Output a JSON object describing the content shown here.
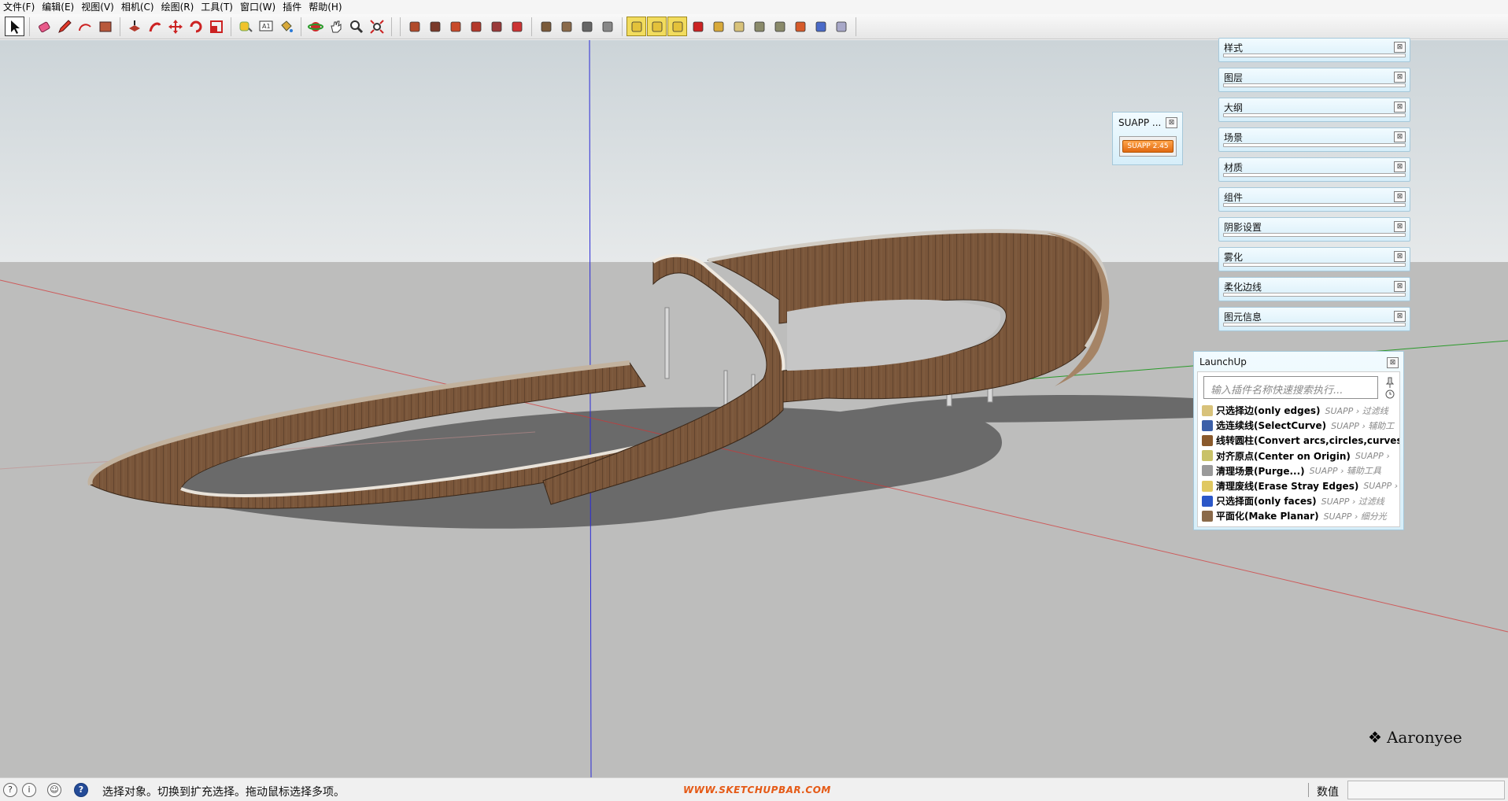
{
  "menubar": {
    "items": [
      "文件(F)",
      "编辑(E)",
      "视图(V)",
      "相机(C)",
      "绘图(R)",
      "工具(T)",
      "窗口(W)",
      "插件",
      "帮助(H)"
    ]
  },
  "toolbar": {
    "tools": [
      {
        "name": "select-tool",
        "icon": "arrow-icon",
        "active": true
      },
      {
        "name": "eraser-tool",
        "icon": "eraser-icon"
      },
      {
        "name": "pencil-tool",
        "icon": "pencil-icon"
      },
      {
        "name": "arc-tool",
        "icon": "arc-icon"
      },
      {
        "name": "shape-tool",
        "icon": "rectangle-icon"
      },
      {
        "name": "push-pull-tool",
        "icon": "push-pull-icon"
      },
      {
        "name": "follow-me-tool",
        "icon": "follow-me-icon"
      },
      {
        "name": "move-tool",
        "icon": "move-icon"
      },
      {
        "name": "rotate-tool",
        "icon": "rotate-icon"
      },
      {
        "name": "scale-tool",
        "icon": "scale-icon"
      },
      {
        "name": "tape-measure-tool",
        "icon": "tape-measure-icon"
      },
      {
        "name": "text-tool",
        "icon": "text-icon"
      },
      {
        "name": "paint-bucket-tool",
        "icon": "paint-bucket-icon"
      },
      {
        "name": "orbit-tool",
        "icon": "orbit-icon"
      },
      {
        "name": "pan-tool",
        "icon": "hand-icon"
      },
      {
        "name": "zoom-tool",
        "icon": "magnifier-icon"
      },
      {
        "name": "zoom-extents-tool",
        "icon": "zoom-extents-icon"
      }
    ]
  },
  "tray": {
    "panels": [
      "样式",
      "图层",
      "大纲",
      "场景",
      "材质",
      "组件",
      "阴影设置",
      "雾化",
      "柔化边线",
      "图元信息"
    ],
    "close_glyph": "⊠"
  },
  "suapp_window": {
    "title": "SUAPP ...",
    "button": "SUAPP 2.45"
  },
  "launchup": {
    "title": "LaunchUp",
    "search_placeholder": "输入插件名称快速搜索执行...",
    "items": [
      {
        "name": "只选择边(only edges)",
        "category": "SUAPP › 过滤线",
        "color": "#d8c27a"
      },
      {
        "name": "选连续线(SelectCurve)",
        "category": "SUAPP › 辅助工",
        "color": "#3b5fa8"
      },
      {
        "name": "线转圆柱(Convert arcs,circles,curves",
        "category": "",
        "color": "#8a5a2c"
      },
      {
        "name": "对齐原点(Center on Origin)",
        "category": "SUAPP ›",
        "color": "#c9c268"
      },
      {
        "name": "清理场景(Purge...)",
        "category": "SUAPP › 辅助工具",
        "color": "#9a9a9a"
      },
      {
        "name": "清理废线(Erase Stray Edges)",
        "category": "SUAPP ›",
        "color": "#e0c860"
      },
      {
        "name": "只选择面(only faces)",
        "category": "SUAPP › 过滤线",
        "color": "#2b57c8"
      },
      {
        "name": "平面化(Make Planar)",
        "category": "SUAPP › 细分光",
        "color": "#8a6a4a"
      }
    ]
  },
  "watermark": {
    "logo_mark": "❖",
    "text": "Aaronyee"
  },
  "statusbar": {
    "message": "选择对象。切换到扩充选择。拖动鼠标选择多项。",
    "site": "WWW.SKETCHUPBAR.COM",
    "value_label": "数值",
    "value": ""
  },
  "colors": {
    "tray_bg": "#d6eef9",
    "wood": "#7a563a",
    "ground": "#bdbdbc",
    "sky": "#e6e9ea",
    "accent_orange": "#e55a16"
  }
}
